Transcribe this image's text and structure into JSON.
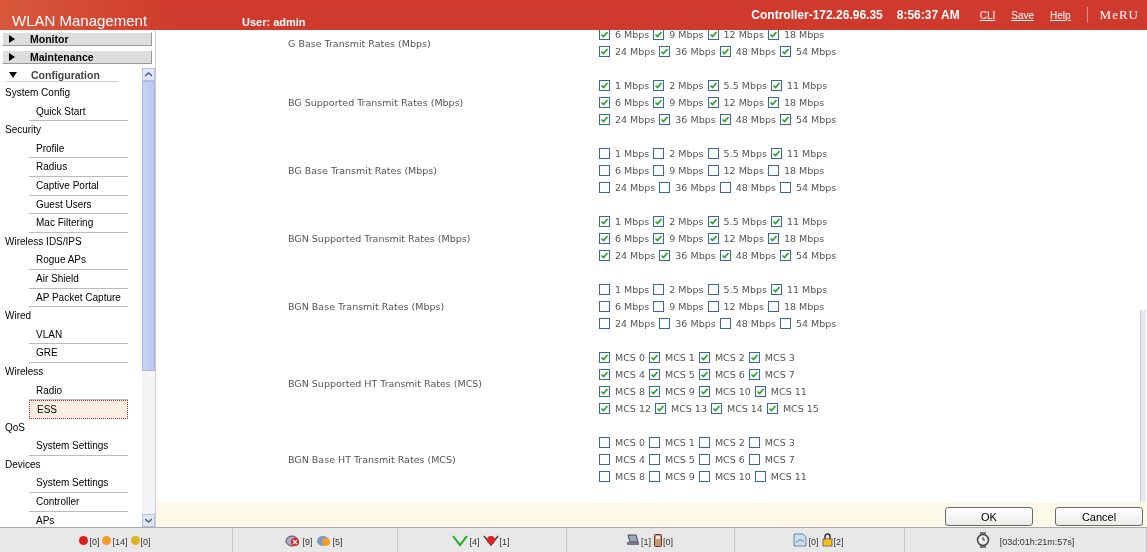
{
  "header": {
    "title": "WLAN Management",
    "user": "User: admin",
    "controller": "Controller-172.26.96.35",
    "time": "8:56:37 AM",
    "links": [
      "CLI",
      "Save",
      "Help"
    ],
    "logo": "MeRU"
  },
  "sidebar": {
    "items": [
      {
        "label": "Monitor",
        "expanded": false
      },
      {
        "label": "Maintenance",
        "expanded": false
      },
      {
        "label": "Configuration",
        "expanded": true,
        "children": [
          {
            "label": "System Config",
            "children": [
              {
                "label": "Quick Start",
                "selected": false
              }
            ]
          },
          {
            "label": "Security",
            "children": [
              {
                "label": "Profile",
                "selected": false
              },
              {
                "label": "Radius",
                "selected": false
              },
              {
                "label": "Captive Portal",
                "selected": false
              },
              {
                "label": "Guest Users",
                "selected": false
              },
              {
                "label": "Mac Filtering",
                "selected": false
              }
            ]
          },
          {
            "label": "Wireless IDS/IPS",
            "children": [
              {
                "label": "Rogue APs",
                "selected": false
              },
              {
                "label": "Air Shield",
                "selected": false
              },
              {
                "label": "AP Packet Capture",
                "selected": false
              }
            ]
          },
          {
            "label": "Wired",
            "children": [
              {
                "label": "VLAN",
                "selected": false
              },
              {
                "label": "GRE",
                "selected": false
              }
            ]
          },
          {
            "label": "Wireless",
            "children": [
              {
                "label": "Radio",
                "selected": false
              },
              {
                "label": "ESS",
                "selected": true
              }
            ]
          },
          {
            "label": "QoS",
            "children": [
              {
                "label": "System Settings",
                "selected": false
              }
            ]
          },
          {
            "label": "Devices",
            "children": [
              {
                "label": "System Settings",
                "selected": false
              },
              {
                "label": "Controller",
                "selected": false
              },
              {
                "label": "APs",
                "selected": false
              }
            ]
          }
        ]
      }
    ]
  },
  "sections": [
    {
      "label": "G Base Transmit Rates (Mbps)",
      "rows": [
        [
          {
            "label": "6 Mbps",
            "checked": true
          },
          {
            "label": "9 Mbps",
            "checked": true
          },
          {
            "label": "12 Mbps",
            "checked": true
          },
          {
            "label": "18 Mbps",
            "checked": true
          }
        ],
        [
          {
            "label": "24 Mbps",
            "checked": true
          },
          {
            "label": "36 Mbps",
            "checked": true
          },
          {
            "label": "48 Mbps",
            "checked": true
          },
          {
            "label": "54 Mbps",
            "checked": true
          }
        ]
      ]
    },
    {
      "label": "BG Supported Transmit Rates (Mbps)",
      "rows": [
        [
          {
            "label": "1 Mbps",
            "checked": true
          },
          {
            "label": "2 Mbps",
            "checked": true
          },
          {
            "label": "5.5 Mbps",
            "checked": true
          },
          {
            "label": "11 Mbps",
            "checked": true
          }
        ],
        [
          {
            "label": "6 Mbps",
            "checked": true
          },
          {
            "label": "9 Mbps",
            "checked": true
          },
          {
            "label": "12 Mbps",
            "checked": true
          },
          {
            "label": "18 Mbps",
            "checked": true
          }
        ],
        [
          {
            "label": "24 Mbps",
            "checked": true
          },
          {
            "label": "36 Mbps",
            "checked": true
          },
          {
            "label": "48 Mbps",
            "checked": true
          },
          {
            "label": "54 Mbps",
            "checked": true
          }
        ]
      ]
    },
    {
      "label": "BG Base Transmit Rates (Mbps)",
      "rows": [
        [
          {
            "label": "1 Mbps",
            "checked": false
          },
          {
            "label": "2 Mbps",
            "checked": false
          },
          {
            "label": "5.5 Mbps",
            "checked": false
          },
          {
            "label": "11 Mbps",
            "checked": true
          }
        ],
        [
          {
            "label": "6 Mbps",
            "checked": false
          },
          {
            "label": "9 Mbps",
            "checked": false
          },
          {
            "label": "12 Mbps",
            "checked": false
          },
          {
            "label": "18 Mbps",
            "checked": false
          }
        ],
        [
          {
            "label": "24 Mbps",
            "checked": false
          },
          {
            "label": "36 Mbps",
            "checked": false
          },
          {
            "label": "48 Mbps",
            "checked": false
          },
          {
            "label": "54 Mbps",
            "checked": false
          }
        ]
      ]
    },
    {
      "label": "BGN Supported Transmit Rates (Mbps)",
      "rows": [
        [
          {
            "label": "1 Mbps",
            "checked": true
          },
          {
            "label": "2 Mbps",
            "checked": true
          },
          {
            "label": "5.5 Mbps",
            "checked": true
          },
          {
            "label": "11 Mbps",
            "checked": true
          }
        ],
        [
          {
            "label": "6 Mbps",
            "checked": true
          },
          {
            "label": "9 Mbps",
            "checked": true
          },
          {
            "label": "12 Mbps",
            "checked": true
          },
          {
            "label": "18 Mbps",
            "checked": true
          }
        ],
        [
          {
            "label": "24 Mbps",
            "checked": true
          },
          {
            "label": "36 Mbps",
            "checked": true
          },
          {
            "label": "48 Mbps",
            "checked": true
          },
          {
            "label": "54 Mbps",
            "checked": true
          }
        ]
      ]
    },
    {
      "label": "BGN Base Transmit Rates (Mbps)",
      "rows": [
        [
          {
            "label": "1 Mbps",
            "checked": false
          },
          {
            "label": "2 Mbps",
            "checked": false
          },
          {
            "label": "5.5 Mbps",
            "checked": false
          },
          {
            "label": "11 Mbps",
            "checked": true
          }
        ],
        [
          {
            "label": "6 Mbps",
            "checked": false
          },
          {
            "label": "9 Mbps",
            "checked": false
          },
          {
            "label": "12 Mbps",
            "checked": false
          },
          {
            "label": "18 Mbps",
            "checked": false
          }
        ],
        [
          {
            "label": "24 Mbps",
            "checked": false
          },
          {
            "label": "36 Mbps",
            "checked": false
          },
          {
            "label": "48 Mbps",
            "checked": false
          },
          {
            "label": "54 Mbps",
            "checked": false
          }
        ]
      ]
    },
    {
      "label": "BGN Supported HT Transmit Rates (MCS)",
      "rows": [
        [
          {
            "label": "MCS 0",
            "checked": true
          },
          {
            "label": "MCS 1",
            "checked": true
          },
          {
            "label": "MCS 2",
            "checked": true
          },
          {
            "label": "MCS 3",
            "checked": true
          }
        ],
        [
          {
            "label": "MCS 4",
            "checked": true
          },
          {
            "label": "MCS 5",
            "checked": true
          },
          {
            "label": "MCS 6",
            "checked": true
          },
          {
            "label": "MCS 7",
            "checked": true
          }
        ],
        [
          {
            "label": "MCS 8",
            "checked": true
          },
          {
            "label": "MCS 9",
            "checked": true
          },
          {
            "label": "MCS 10",
            "checked": true
          },
          {
            "label": "MCS 11",
            "checked": true
          }
        ],
        [
          {
            "label": "MCS 12",
            "checked": true
          },
          {
            "label": "MCS 13",
            "checked": true
          },
          {
            "label": "MCS 14",
            "checked": true
          },
          {
            "label": "MCS 15",
            "checked": true
          }
        ]
      ]
    },
    {
      "label": "BGN Base HT Transmit Rates (MCS)",
      "rows": [
        [
          {
            "label": "MCS 0",
            "checked": false
          },
          {
            "label": "MCS 1",
            "checked": false
          },
          {
            "label": "MCS 2",
            "checked": false
          },
          {
            "label": "MCS 3",
            "checked": false
          }
        ],
        [
          {
            "label": "MCS 4",
            "checked": false
          },
          {
            "label": "MCS 5",
            "checked": false
          },
          {
            "label": "MCS 6",
            "checked": false
          },
          {
            "label": "MCS 7",
            "checked": false
          }
        ],
        [
          {
            "label": "MCS 8",
            "checked": false
          },
          {
            "label": "MCS 9",
            "checked": false
          },
          {
            "label": "MCS 10",
            "checked": false
          },
          {
            "label": "MCS 11",
            "checked": false
          }
        ]
      ]
    }
  ],
  "buttons": [
    "OK",
    "Cancel"
  ],
  "status_bar": [
    {
      "items": [
        {
          "kind": "dot",
          "color": "#d81e1e",
          "text": "[0]"
        },
        {
          "kind": "dot",
          "color": "#f39a2b",
          "text": "[14]"
        },
        {
          "kind": "dot",
          "color": "#d8b81e",
          "text": "[0]"
        }
      ]
    },
    {
      "items": [
        {
          "kind": "ap-down",
          "text": "[9]"
        },
        {
          "kind": "ap-warn",
          "text": "[5]"
        }
      ]
    },
    {
      "items": [
        {
          "kind": "shield-ok",
          "text": "[4]"
        },
        {
          "kind": "shield-alert",
          "text": "[1]"
        }
      ]
    },
    {
      "items": [
        {
          "kind": "laptop",
          "text": "[1]"
        },
        {
          "kind": "phone",
          "text": "[0]"
        }
      ]
    },
    {
      "items": [
        {
          "kind": "page",
          "text": "[0]"
        },
        {
          "kind": "lock",
          "text": "[2]"
        }
      ]
    },
    {
      "items": [
        {
          "kind": "watch",
          "text": "[03d:01h:21m:57s]"
        }
      ]
    }
  ]
}
